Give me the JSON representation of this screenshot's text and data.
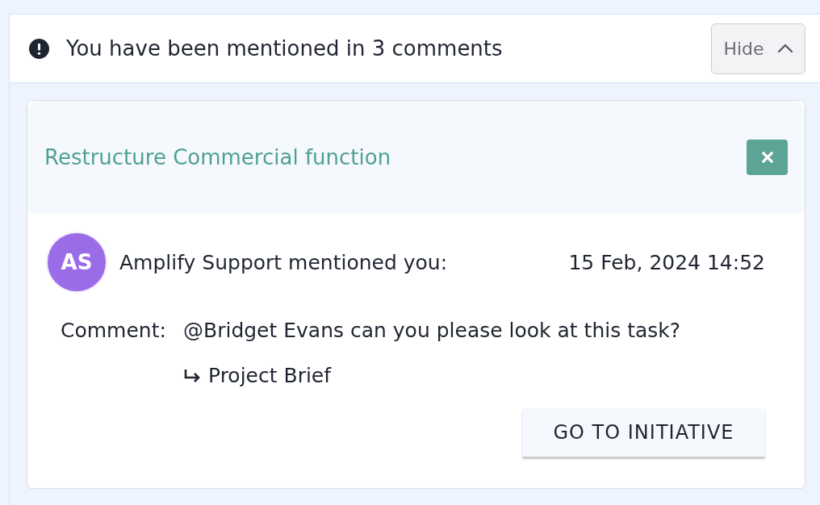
{
  "notice": {
    "message": "You have been mentioned in 3 comments",
    "toggle_label": "Hide",
    "expanded": true
  },
  "mentions": [
    {
      "title": "Restructure Commercial function",
      "author_initials": "AS",
      "author_line": "Amplify Support mentioned you:",
      "timestamp": "15 Feb, 2024 14:52",
      "comment_label": "Comment:",
      "comment": "@Bridget Evans can you please look at this task?",
      "reference": "Project Brief",
      "action_label": "GO TO INITIATIVE"
    }
  ]
}
